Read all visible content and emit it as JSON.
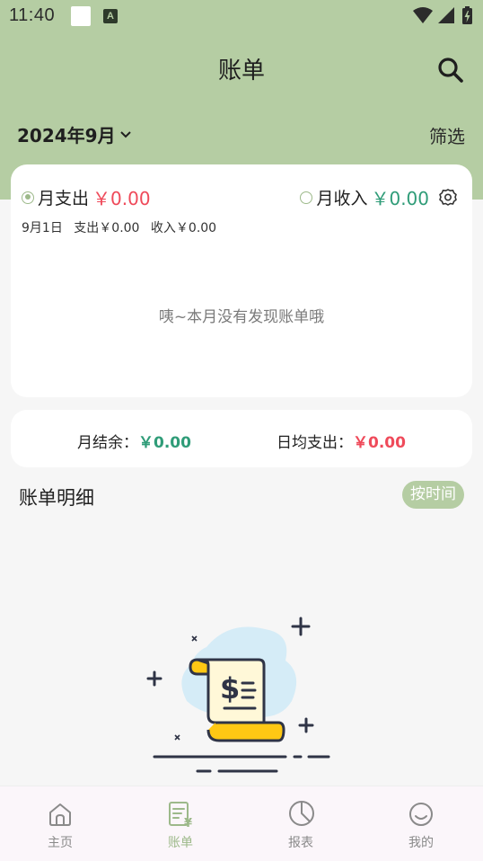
{
  "status_bar": {
    "time": "11:40",
    "badge_letter": "A"
  },
  "header": {
    "title": "账单",
    "search_icon": "search-icon"
  },
  "filters": {
    "month": "2024年9月",
    "filter_label": "筛选"
  },
  "summary": {
    "expense_label": "月支出",
    "expense_amount": "￥0.00",
    "income_label": "月收入",
    "income_amount": "￥0.00",
    "day_date": "9月1日",
    "day_expense": "支出￥0.00",
    "day_income": "收入￥0.00",
    "empty_message": "咦~本月没有发现账单哦",
    "selected": "expense"
  },
  "balance": {
    "remaining_label": "月结余：",
    "remaining_amount": "￥0.00",
    "daily_avg_label": "日均支出：",
    "daily_avg_amount": "￥0.00"
  },
  "details": {
    "title": "账单明细",
    "sort_label": "按时间"
  },
  "bottom_nav": [
    {
      "label": "主页",
      "icon": "home-icon",
      "active": false
    },
    {
      "label": "账单",
      "icon": "bill-icon",
      "active": true
    },
    {
      "label": "报表",
      "icon": "pie-chart-icon",
      "active": false
    },
    {
      "label": "我的",
      "icon": "smile-icon",
      "active": false
    }
  ],
  "colors": {
    "accent": "#b5cda3",
    "expense": "#ef4a5a",
    "income": "#2f9c78"
  }
}
